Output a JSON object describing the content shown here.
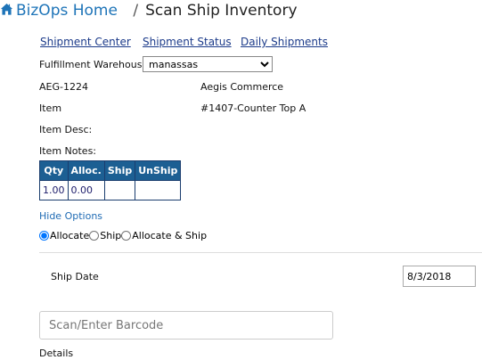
{
  "breadcrumb": {
    "home_label": "BizOps Home",
    "separator": "/",
    "title": "Scan Ship Inventory"
  },
  "nav": {
    "shipment_center": "Shipment Center",
    "shipment_status": "Shipment Status",
    "daily_shipments": "Daily Shipments"
  },
  "warehouse": {
    "label": "Fulfillment Warehouse",
    "selected": "manassas"
  },
  "item_info": {
    "code": "AEG-1224",
    "company": "Aegis Commerce",
    "item_label": "Item",
    "item_value": "#1407-Counter Top A",
    "desc_label": "Item Desc:",
    "notes_label": "Item Notes:"
  },
  "qty_table": {
    "headers": [
      "Qty",
      "Alloc.",
      "Ship",
      "UnShip"
    ],
    "row": [
      "1.00",
      "0.00",
      "",
      ""
    ]
  },
  "options": {
    "hide_label": "Hide Options",
    "radios": [
      "Allocate",
      "Ship",
      "Allocate & Ship"
    ],
    "selected": "Allocate"
  },
  "ship_date": {
    "label": "Ship Date",
    "value": "8/3/2018"
  },
  "scan": {
    "placeholder": "Scan/Enter Barcode"
  },
  "details_label": "Details"
}
